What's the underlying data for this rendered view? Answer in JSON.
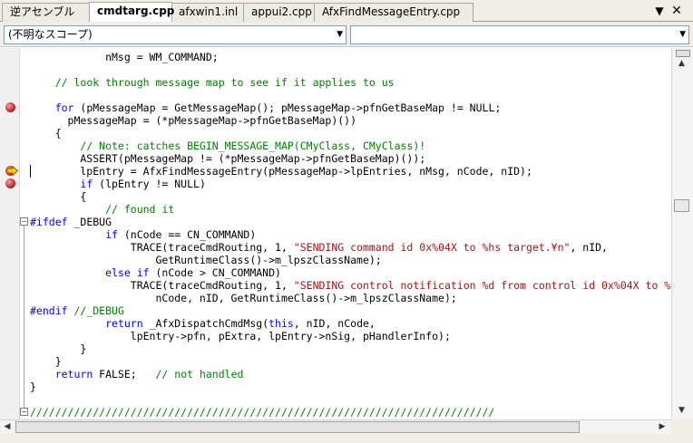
{
  "tabs": [
    {
      "label": "逆アセンブル",
      "active": false
    },
    {
      "label": "cmdtarg.cpp",
      "active": true
    },
    {
      "label": "afxwin1.inl",
      "active": false
    },
    {
      "label": "appui2.cpp",
      "active": false
    },
    {
      "label": "AfxFindMessageEntry.cpp",
      "active": false
    }
  ],
  "tab_controls": {
    "dropdown_icon": "▼",
    "close_icon": "✕"
  },
  "scope": {
    "left_value": "(不明なスコープ)",
    "right_value": ""
  },
  "code_lines": [
    [
      {
        "t": "            nMsg = WM_COMMAND;"
      }
    ],
    [
      {
        "t": ""
      }
    ],
    [
      {
        "t": "    "
      },
      {
        "t": "// look through message map to see if it applies to us",
        "c": "cm"
      }
    ],
    [
      {
        "t": ""
      }
    ],
    [
      {
        "t": "    "
      },
      {
        "t": "for",
        "c": "kw"
      },
      {
        "t": " (pMessageMap = GetMessageMap(); pMessageMap->pfnGetBaseMap != NULL;"
      }
    ],
    [
      {
        "t": "      pMessageMap = (*pMessageMap->pfnGetBaseMap)())"
      }
    ],
    [
      {
        "t": "    {"
      }
    ],
    [
      {
        "t": "        "
      },
      {
        "t": "// Note: catches BEGIN_MESSAGE_MAP(CMyClass, CMyClass)!",
        "c": "cm"
      }
    ],
    [
      {
        "t": "        ASSERT(pMessageMap != (*pMessageMap->pfnGetBaseMap)());"
      }
    ],
    [
      {
        "t": "        lpEntry = AfxFindMessageEntry(pMessageMap->lpEntries, nMsg, nCode, nID);"
      }
    ],
    [
      {
        "t": "        "
      },
      {
        "t": "if",
        "c": "kw"
      },
      {
        "t": " (lpEntry != NULL)"
      }
    ],
    [
      {
        "t": "        {"
      }
    ],
    [
      {
        "t": "            "
      },
      {
        "t": "// found it",
        "c": "cm"
      }
    ],
    [
      {
        "t": "#ifdef",
        "c": "kw"
      },
      {
        "t": " _DEBUG"
      }
    ],
    [
      {
        "t": "            "
      },
      {
        "t": "if",
        "c": "kw"
      },
      {
        "t": " (nCode == CN_COMMAND)"
      }
    ],
    [
      {
        "t": "                TRACE(traceCmdRouting, 1, "
      },
      {
        "t": "\"SENDING command id 0x%04X to %hs target.¥n\"",
        "c": "st"
      },
      {
        "t": ", nID,"
      }
    ],
    [
      {
        "t": "                    GetRuntimeClass()->m_lpszClassName);"
      }
    ],
    [
      {
        "t": "            "
      },
      {
        "t": "else if",
        "c": "kw"
      },
      {
        "t": " (nCode > CN_COMMAND)"
      }
    ],
    [
      {
        "t": "                TRACE(traceCmdRouting, 1, "
      },
      {
        "t": "\"SENDING control notification %d from control id 0x%04X to %",
        "c": "st"
      }
    ],
    [
      {
        "t": "                    nCode, nID, GetRuntimeClass()->m_lpszClassName);"
      }
    ],
    [
      {
        "t": "#endif",
        "c": "kw"
      },
      {
        "t": " "
      },
      {
        "t": "//_DEBUG",
        "c": "cm"
      }
    ],
    [
      {
        "t": "            "
      },
      {
        "t": "return",
        "c": "kw"
      },
      {
        "t": " _AfxDispatchCmdMsg("
      },
      {
        "t": "this",
        "c": "kw"
      },
      {
        "t": ", nID, nCode,"
      }
    ],
    [
      {
        "t": "                lpEntry->pfn, pExtra, lpEntry->nSig, pHandlerInfo);"
      }
    ],
    [
      {
        "t": "        }"
      }
    ],
    [
      {
        "t": "    }"
      }
    ],
    [
      {
        "t": "    "
      },
      {
        "t": "return",
        "c": "kw"
      },
      {
        "t": " FALSE;   "
      },
      {
        "t": "// not handled",
        "c": "cm"
      }
    ],
    [
      {
        "t": "}"
      }
    ],
    [
      {
        "t": ""
      }
    ],
    [
      {
        "t": "//////////////////////////////////////////////////////////////////////////",
        "c": "cm"
      }
    ]
  ],
  "breakpoint_lines": [
    4,
    9,
    10
  ],
  "current_line": 9,
  "outline_collapse_lines": [
    13,
    28
  ],
  "colors": {
    "keyword": "#0000ff",
    "comment": "#008000",
    "string": "#a31515",
    "breakpoint": "#c41e1e",
    "current_arrow": "#f5d000"
  }
}
